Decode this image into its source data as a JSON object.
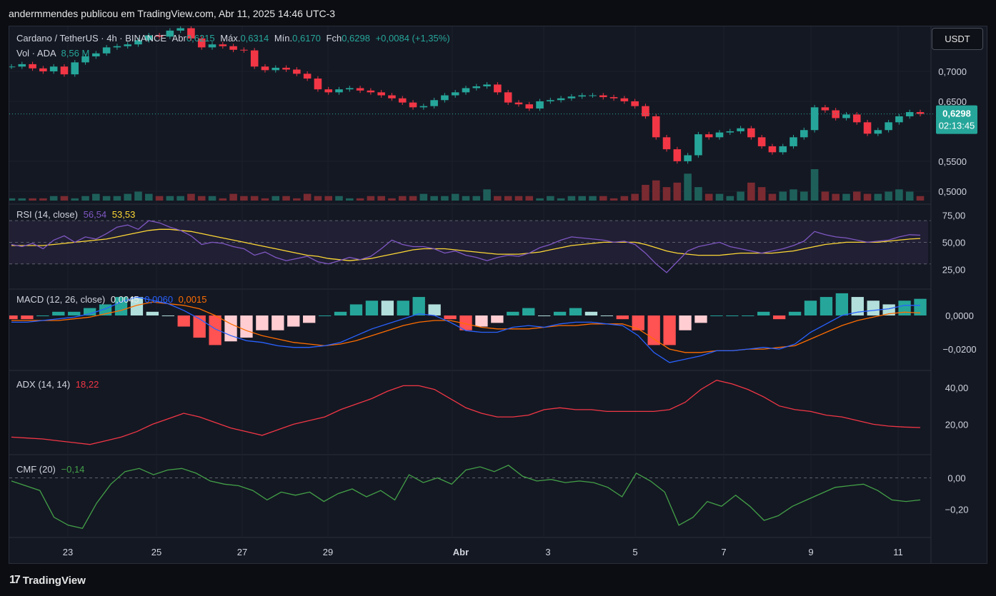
{
  "attribution": "andermmendes publicou em TradingView.com, Abr 11, 2025 14:46 UTC-3",
  "footer_logo": "TradingView",
  "currency_button": "USDT",
  "colors": {
    "up": "#26a69a",
    "down": "#f23645",
    "rsi": "#7e57c2",
    "rsi_ma": "#fdd835",
    "macd": "#2962ff",
    "signal": "#ff6d00",
    "adx": "#f23645",
    "cmf": "#43a047"
  },
  "header": {
    "symbol": "Cardano / TetherUS · 4h · BINANCE",
    "open_label": "Abr",
    "open_value": "0,6215",
    "high_label": "Máx.",
    "high_value": "0,6314",
    "low_label": "Mín.",
    "low_value": "0,6170",
    "close_label": "Fch",
    "close_value": "0,6298",
    "change": "+0,0084 (+1,35%)",
    "vol_label": "Vol · ADA",
    "vol_value": "8,56 M"
  },
  "price_badge": {
    "price": "0,6298",
    "countdown": "02:13:45"
  },
  "indicators": {
    "rsi": {
      "label": "RSI (14, close)",
      "value": "56,54",
      "ma_value": "53,53"
    },
    "macd": {
      "label": "MACD (12, 26, close)",
      "hist": "0,0045",
      "macd": "0,0060",
      "signal": "0,0015"
    },
    "adx": {
      "label": "ADX (14, 14)",
      "value": "18,22"
    },
    "cmf": {
      "label": "CMF (20)",
      "value": "−0,14"
    }
  },
  "chart_data": {
    "type": "candlestick",
    "x_ticks": [
      "23",
      "25",
      "27",
      "29",
      "Abr",
      "3",
      "5",
      "7",
      "9",
      "11"
    ],
    "price_axis": {
      "ticks": [
        "0,7000",
        "0,6500",
        "0,5500",
        "0,5000"
      ],
      "tick_values": [
        0.7,
        0.65,
        0.55,
        0.5
      ],
      "range": [
        0.482,
        0.775
      ]
    },
    "price_series": [
      0.708,
      0.712,
      0.705,
      0.7,
      0.708,
      0.695,
      0.715,
      0.725,
      0.73,
      0.74,
      0.742,
      0.745,
      0.752,
      0.76,
      0.758,
      0.768,
      0.772,
      0.755,
      0.74,
      0.745,
      0.742,
      0.736,
      0.735,
      0.708,
      0.702,
      0.706,
      0.703,
      0.696,
      0.688,
      0.67,
      0.665,
      0.67,
      0.672,
      0.668,
      0.665,
      0.66,
      0.655,
      0.648,
      0.64,
      0.642,
      0.652,
      0.66,
      0.665,
      0.672,
      0.675,
      0.678,
      0.665,
      0.648,
      0.645,
      0.638,
      0.65,
      0.652,
      0.655,
      0.658,
      0.66,
      0.66,
      0.657,
      0.655,
      0.65,
      0.642,
      0.625,
      0.59,
      0.57,
      0.55,
      0.56,
      0.595,
      0.59,
      0.598,
      0.6,
      0.605,
      0.59,
      0.575,
      0.565,
      0.575,
      0.59,
      0.602,
      0.64,
      0.635,
      0.622,
      0.628,
      0.615,
      0.596,
      0.602,
      0.615,
      0.625,
      0.632,
      0.629
    ],
    "volume_series": [
      1,
      1,
      1,
      1,
      2,
      2,
      1,
      2,
      3,
      2,
      2,
      3,
      4,
      3,
      2,
      2,
      2,
      3,
      2,
      2,
      1,
      3,
      2,
      2,
      1,
      2,
      2,
      1,
      3,
      2,
      2,
      2,
      1,
      1,
      2,
      2,
      1,
      2,
      2,
      3,
      2,
      2,
      3,
      2,
      2,
      5,
      2,
      2,
      2,
      2,
      1,
      2,
      1,
      2,
      2,
      2,
      2,
      1,
      2,
      3,
      7,
      9,
      6,
      8,
      12,
      6,
      3,
      3,
      2,
      4,
      8,
      6,
      3,
      4,
      5,
      4,
      14,
      4,
      3,
      3,
      4,
      3,
      3,
      4,
      5,
      4,
      2
    ],
    "volume_unit": "M ADA",
    "rsi": {
      "axis_ticks": [
        "75,00",
        "50,00",
        "25,00"
      ],
      "tick_values": [
        75,
        50,
        25
      ],
      "bands": [
        30,
        70
      ],
      "rsi_series": [
        48,
        46,
        49,
        44,
        52,
        56,
        50,
        55,
        53,
        58,
        64,
        66,
        62,
        70,
        68,
        64,
        61,
        56,
        48,
        50,
        49,
        46,
        44,
        38,
        41,
        36,
        33,
        35,
        37,
        32,
        30,
        33,
        36,
        34,
        37,
        44,
        52,
        48,
        46,
        46,
        44,
        40,
        42,
        38,
        36,
        33,
        36,
        38,
        37,
        40,
        45,
        48,
        52,
        55,
        54,
        53,
        52,
        50,
        51,
        48,
        40,
        30,
        22,
        32,
        42,
        46,
        48,
        50,
        46,
        44,
        42,
        40,
        42,
        44,
        47,
        51,
        60,
        57,
        55,
        54,
        52,
        50,
        51,
        52,
        55,
        57,
        56.54
      ],
      "ma_series": [
        47,
        47,
        47,
        47,
        48,
        49,
        50,
        51,
        52,
        53,
        55,
        57,
        59,
        61,
        62,
        62,
        61,
        60,
        58,
        56,
        54,
        52,
        50,
        48,
        46,
        44,
        42,
        40,
        38,
        37,
        35,
        34,
        33,
        34,
        35,
        37,
        39,
        41,
        43,
        44,
        44,
        44,
        43,
        42,
        41,
        40,
        39,
        39,
        39,
        40,
        41,
        43,
        45,
        47,
        48,
        49,
        50,
        50,
        50,
        50,
        48,
        45,
        42,
        40,
        39,
        38,
        38,
        38,
        39,
        40,
        40,
        40,
        40,
        41,
        42,
        44,
        46,
        48,
        49,
        50,
        50,
        50,
        50,
        51,
        52,
        53,
        53.53
      ]
    },
    "macd": {
      "axis_ticks": [
        "0,0000",
        "−0,0200"
      ],
      "tick_values": [
        0,
        -0.02
      ],
      "macd_series": [
        -0.004,
        -0.004,
        -0.003,
        -0.002,
        -0.001,
        0.001,
        0.004,
        0.008,
        0.011,
        0.009,
        0.007,
        0.003,
        -0.002,
        -0.008,
        -0.012,
        -0.015,
        -0.016,
        -0.018,
        -0.019,
        -0.019,
        -0.018,
        -0.016,
        -0.012,
        -0.008,
        -0.005,
        -0.002,
        0.001,
        0.0,
        -0.004,
        -0.009,
        -0.01,
        -0.01,
        -0.007,
        -0.006,
        -0.007,
        -0.005,
        -0.004,
        -0.004,
        -0.005,
        -0.006,
        -0.012,
        -0.022,
        -0.028,
        -0.026,
        -0.024,
        -0.021,
        -0.021,
        -0.02,
        -0.019,
        -0.02,
        -0.017,
        -0.01,
        -0.005,
        0.0,
        0.002,
        0.003,
        0.004,
        0.006,
        0.006
      ],
      "signal_series": [
        -0.003,
        -0.003,
        -0.003,
        -0.003,
        -0.002,
        -0.001,
        0.001,
        0.003,
        0.006,
        0.008,
        0.007,
        0.006,
        0.004,
        0.0,
        -0.005,
        -0.009,
        -0.012,
        -0.014,
        -0.016,
        -0.017,
        -0.018,
        -0.017,
        -0.015,
        -0.012,
        -0.009,
        -0.006,
        -0.004,
        -0.003,
        -0.003,
        -0.005,
        -0.007,
        -0.008,
        -0.008,
        -0.008,
        -0.007,
        -0.006,
        -0.006,
        -0.005,
        -0.005,
        -0.005,
        -0.008,
        -0.014,
        -0.02,
        -0.022,
        -0.022,
        -0.021,
        -0.021,
        -0.02,
        -0.02,
        -0.019,
        -0.018,
        -0.014,
        -0.01,
        -0.006,
        -0.003,
        -0.001,
        0.001,
        0.002,
        0.0015
      ]
    },
    "adx": {
      "axis_ticks": [
        "40,00",
        "20,00"
      ],
      "tick_values": [
        40,
        20
      ],
      "adx_series": [
        13,
        12.5,
        12,
        11,
        10,
        9,
        11,
        13,
        16,
        20,
        23,
        26,
        24,
        21,
        18,
        16,
        14,
        17,
        20,
        22,
        24,
        28,
        31,
        34,
        38,
        41,
        41,
        39,
        34,
        29,
        26,
        24,
        24,
        25,
        28,
        29,
        28,
        28,
        27,
        27,
        27,
        27,
        28,
        32,
        39,
        44,
        42,
        39,
        35,
        30,
        28,
        27,
        25,
        24,
        22,
        20,
        19,
        18.5,
        18.22
      ]
    },
    "cmf": {
      "axis_ticks": [
        "0,00",
        "−0,20"
      ],
      "tick_values": [
        0,
        -0.2
      ],
      "dashed_level": 0,
      "cmf_series": [
        -0.02,
        -0.05,
        -0.08,
        -0.25,
        -0.3,
        -0.32,
        -0.16,
        -0.04,
        0.04,
        0.06,
        0.02,
        0.05,
        0.06,
        0.03,
        -0.02,
        -0.04,
        -0.05,
        -0.08,
        -0.14,
        -0.09,
        -0.11,
        -0.09,
        -0.15,
        -0.1,
        -0.07,
        -0.12,
        -0.08,
        -0.14,
        0.02,
        -0.03,
        0.0,
        -0.04,
        0.05,
        0.07,
        0.04,
        0.08,
        0.01,
        -0.02,
        -0.01,
        -0.03,
        -0.02,
        -0.03,
        -0.06,
        -0.12,
        0.03,
        -0.02,
        -0.09,
        -0.3,
        -0.25,
        -0.15,
        -0.18,
        -0.11,
        -0.18,
        -0.27,
        -0.24,
        -0.18,
        -0.14,
        -0.1,
        -0.06,
        -0.05,
        -0.04,
        -0.08,
        -0.14,
        -0.15,
        -0.14
      ]
    }
  }
}
